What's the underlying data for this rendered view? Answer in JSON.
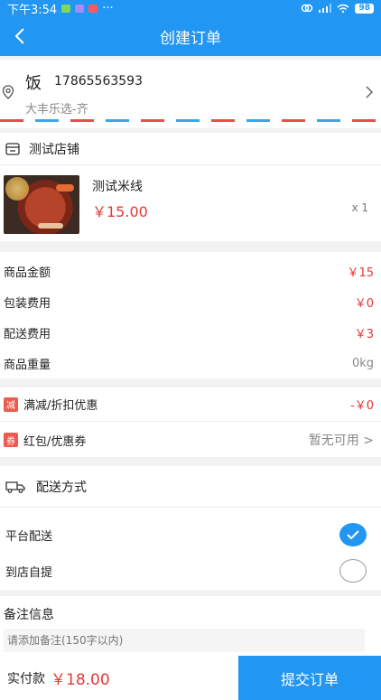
{
  "status_bar": {
    "time": "下午3:54",
    "dots": "···",
    "battery": "98"
  },
  "header": {
    "title": "创建订单"
  },
  "address": {
    "name": "饭",
    "phone": "17865563593",
    "detail": "大丰乐选-齐"
  },
  "shop": {
    "name": "测试店铺",
    "product": {
      "name": "测试米线",
      "price": "￥15.00",
      "qty": "x 1"
    }
  },
  "fees": [
    {
      "label": "商品金额",
      "value": "￥15"
    },
    {
      "label": "包装费用",
      "value": "￥0"
    },
    {
      "label": "配送费用",
      "value": "￥3"
    },
    {
      "label": "商品重量",
      "value": "0kg"
    }
  ],
  "discounts": {
    "promo": {
      "tag": "减",
      "label": "满减/折扣优惠",
      "value": "-￥0"
    },
    "coupon": {
      "tag": "券",
      "label": "红包/优惠券",
      "value": "暂无可用 >"
    }
  },
  "delivery": {
    "title": "配送方式",
    "options": [
      {
        "label": "平台配送",
        "selected": true
      },
      {
        "label": "到店自提",
        "selected": false
      }
    ]
  },
  "remark": {
    "label": "备注信息",
    "placeholder": "请添加备注(150字以内)"
  },
  "footer": {
    "total_label": "实付款",
    "total": "￥18.00",
    "submit": "提交订单"
  },
  "colors": {
    "primary": "#2196f3",
    "price_red": "#e53935",
    "tag_red": "#ee5a4d"
  }
}
